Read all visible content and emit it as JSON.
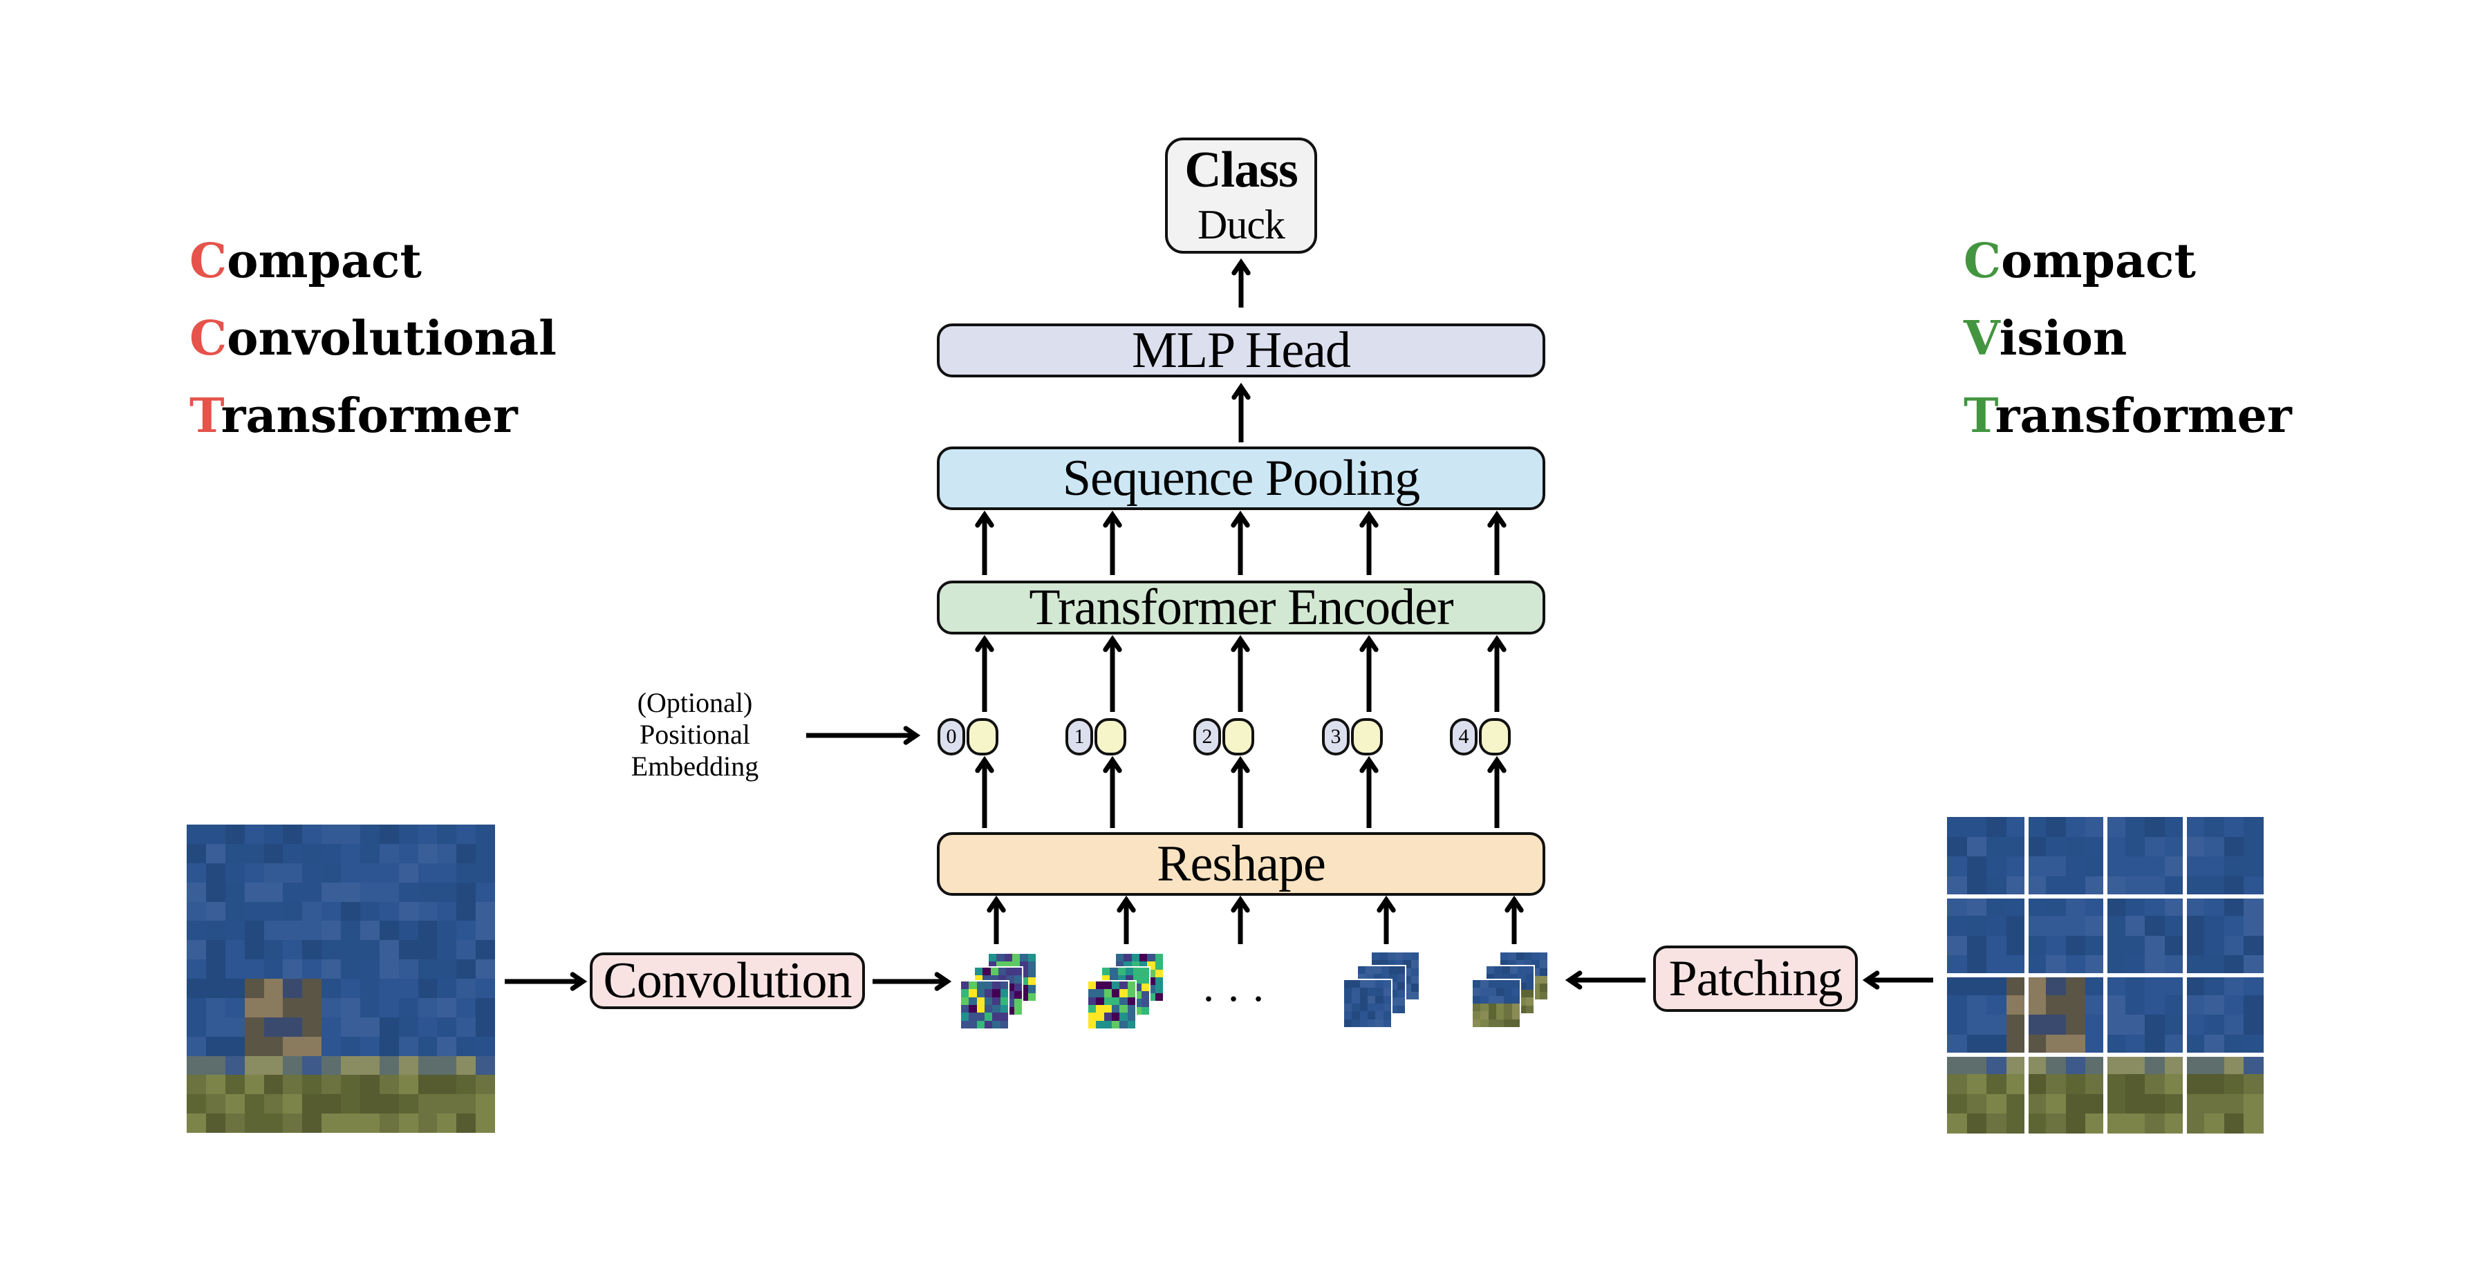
{
  "left_title": {
    "lines": [
      {
        "initial": "C",
        "rest": "ompact"
      },
      {
        "initial": "C",
        "rest": "onvolutional"
      },
      {
        "initial": "T",
        "rest": "ransformer"
      }
    ],
    "accent_color": "#e5534b"
  },
  "right_title": {
    "lines": [
      {
        "initial": "C",
        "rest": "ompact"
      },
      {
        "initial": "V",
        "rest": "ision"
      },
      {
        "initial": "T",
        "rest": "ransformer"
      }
    ],
    "accent_color": "#43953f"
  },
  "class_box": {
    "title": "Class",
    "value": "Duck",
    "color": "#f2f2f2"
  },
  "blocks": {
    "mlp_head": {
      "label": "MLP Head",
      "color": "#dcdfee"
    },
    "sequence_pooling": {
      "label": "Sequence Pooling",
      "color": "#cce6f4"
    },
    "transformer_encoder": {
      "label": "Transformer Encoder",
      "color": "#d3e8d3"
    },
    "reshape": {
      "label": "Reshape",
      "color": "#fae3c2"
    },
    "convolution": {
      "label": "Convolution",
      "color": "#f8e2e2"
    },
    "patching": {
      "label": "Patching",
      "color": "#f8e2e2"
    }
  },
  "positional_embedding": {
    "lines": [
      "(Optional)",
      "Positional",
      "Embedding"
    ]
  },
  "tokens": [
    {
      "index": "0"
    },
    {
      "index": "1"
    },
    {
      "index": "2"
    },
    {
      "index": "3"
    },
    {
      "index": "4"
    }
  ],
  "token_colors": {
    "position": "#dcdfee",
    "embedding": "#f5f5c9"
  },
  "ellipsis": "...",
  "patch_grid": {
    "rows": 4,
    "cols": 4
  }
}
